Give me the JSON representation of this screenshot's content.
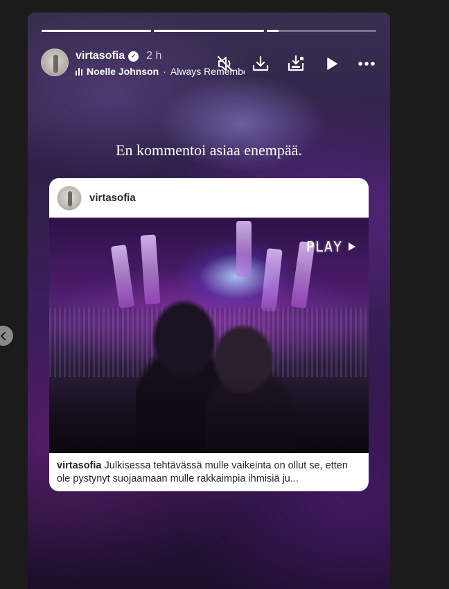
{
  "story": {
    "progress": [
      1.0,
      1.0,
      0.11
    ],
    "header": {
      "username": "virtasofia",
      "verified": true,
      "time_ago": "2 h",
      "music": {
        "artist": "Noelle Johnson",
        "separator": "·",
        "track": "Always Remember Us This Way"
      },
      "actions": [
        "muted-speaker-icon",
        "download-icon",
        "save-icon",
        "play-icon",
        "more-icon"
      ]
    },
    "text_overlay": "En kommentoi asiaa enempää.",
    "shared_post": {
      "username": "virtasofia",
      "play_label": "PLAY",
      "caption_user": "virtasofia",
      "caption_text": "Julkisessa tehtävässä mulle vaikeinta on ollut se, etten ole pystynyt suojaamaan mulle rakkaimpia ihmisiä ju..."
    }
  },
  "nav": {
    "previous_icon": "chevron-left-icon"
  },
  "colors": {
    "page_bg": "#1b1b1b",
    "card_bg": "#ffffff",
    "text_dark": "#262626"
  }
}
